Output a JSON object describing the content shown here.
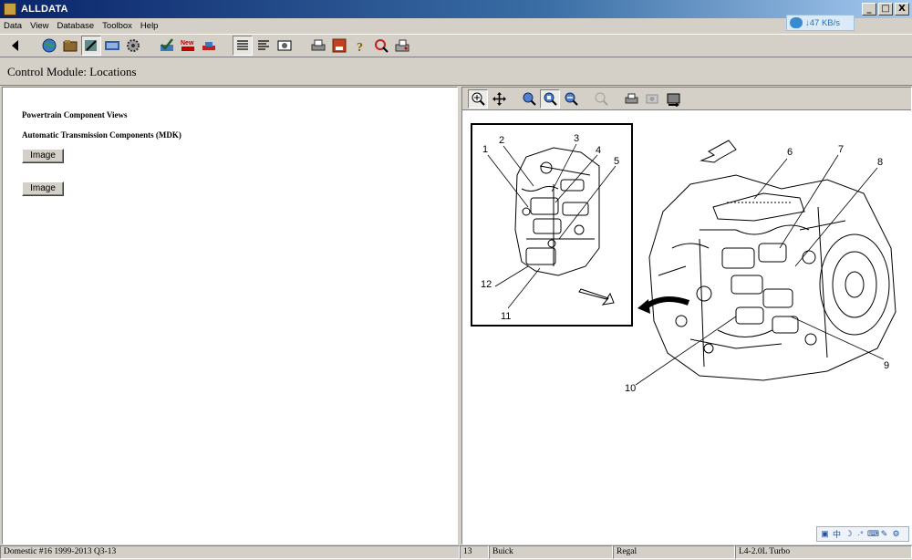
{
  "window": {
    "title": "ALLDATA",
    "buttons": [
      "_",
      "□",
      "X"
    ]
  },
  "menu": [
    "Data",
    "View",
    "Database",
    "Toolbox",
    "Help"
  ],
  "toolbar": {
    "icons": [
      "back-icon",
      "globe-icon",
      "folder-icon",
      "tools-icon",
      "tsb-icon",
      "gear-icon",
      "checkmark-icon",
      "new-car-icon",
      "car-icon",
      "list-icon",
      "text-icon",
      "image-view-icon",
      "print-icon",
      "add-icon",
      "help-icon",
      "zoom-icon",
      "fax-icon"
    ]
  },
  "network_speed": "↓47 KB/s",
  "page_header": "Control Module:  Locations",
  "left": {
    "heading1": "Powertrain Component Views",
    "heading2": "Automatic Transmission Components (MDK)",
    "image_buttons": [
      "Image",
      "Image"
    ]
  },
  "image_toolbar": {
    "icons": [
      "zoom-in-icon",
      "pan-icon",
      "zoom-region-icon",
      "zoom-fit-icon",
      "zoom-out-icon",
      "zoom-disabled-icon",
      "print-icon",
      "copy-icon",
      "export-icon"
    ]
  },
  "diagram": {
    "callouts": [
      "1",
      "2",
      "3",
      "4",
      "5",
      "6",
      "7",
      "8",
      "9",
      "10",
      "11",
      "12"
    ]
  },
  "status": {
    "database": "Domestic #16 1999-2013 Q3-13",
    "year": "13",
    "make": "Buick",
    "model": "Regal",
    "engine": "L4-2.0L Turbo"
  },
  "tray": [
    "中",
    "☽",
    "·°",
    "⌨",
    "✎",
    "⚙"
  ]
}
